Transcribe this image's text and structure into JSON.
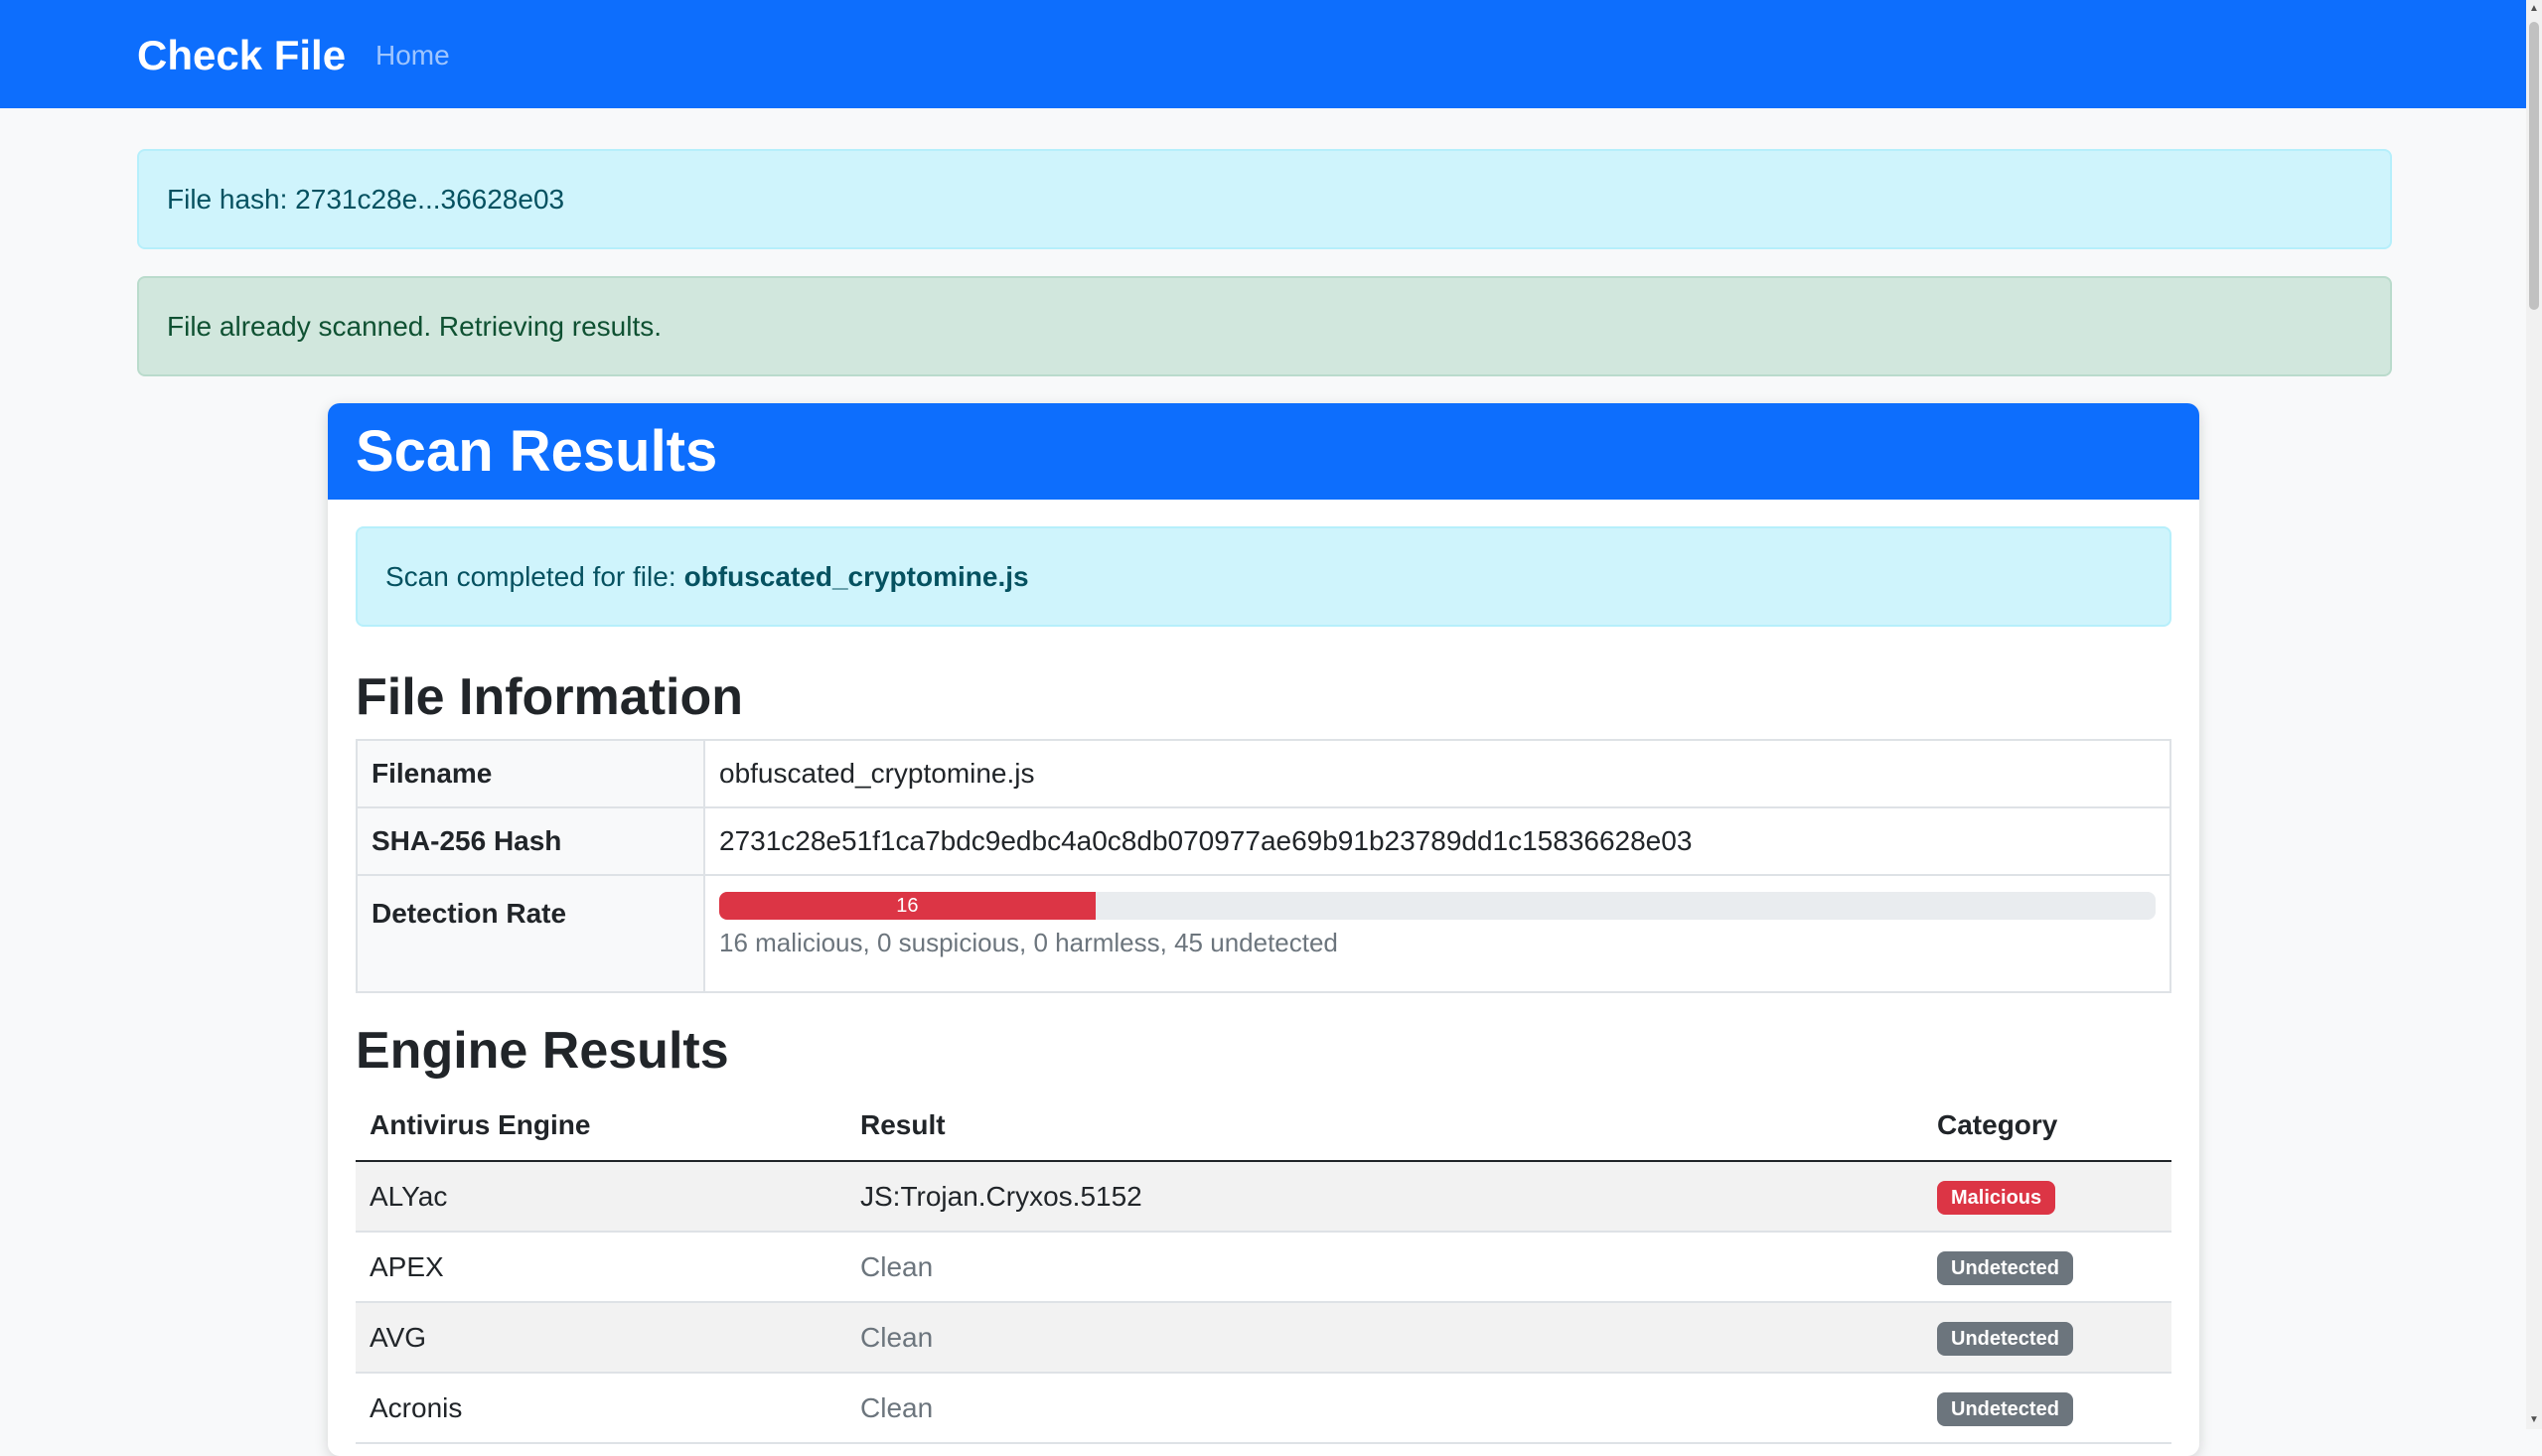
{
  "navbar": {
    "brand": "Check File",
    "home": "Home"
  },
  "alerts": {
    "hash": "File hash: 2731c28e...36628e03",
    "scanned": "File already scanned. Retrieving results."
  },
  "card": {
    "title": "Scan Results",
    "completed_prefix": "Scan completed for file:",
    "completed_file": "obfuscated_cryptomine.js",
    "file_info_title": "File Information",
    "file_info": {
      "filename_label": "Filename",
      "filename": "obfuscated_cryptomine.js",
      "hash_label": "SHA-256 Hash",
      "hash": "2731c28e51f1ca7bdc9edbc4a0c8db070977ae69b91b23789dd1c15836628e03",
      "detection_label": "Detection Rate",
      "detection_value": "16",
      "detection_fraction": 0.262,
      "detection_summary": "16 malicious, 0 suspicious, 0 harmless, 45 undetected"
    },
    "engine_title": "Engine Results",
    "engine_headers": [
      "Antivirus Engine",
      "Result",
      "Category"
    ],
    "engines": [
      {
        "engine": "ALYac",
        "result": "JS:Trojan.Cryxos.5152",
        "category": "Malicious"
      },
      {
        "engine": "APEX",
        "result": "Clean",
        "category": "Undetected"
      },
      {
        "engine": "AVG",
        "result": "Clean",
        "category": "Undetected"
      },
      {
        "engine": "Acronis",
        "result": "Clean",
        "category": "Undetected"
      }
    ]
  },
  "colors": {
    "primary": "#0d6efd",
    "danger": "#dc3545",
    "secondary": "#6c757d"
  }
}
